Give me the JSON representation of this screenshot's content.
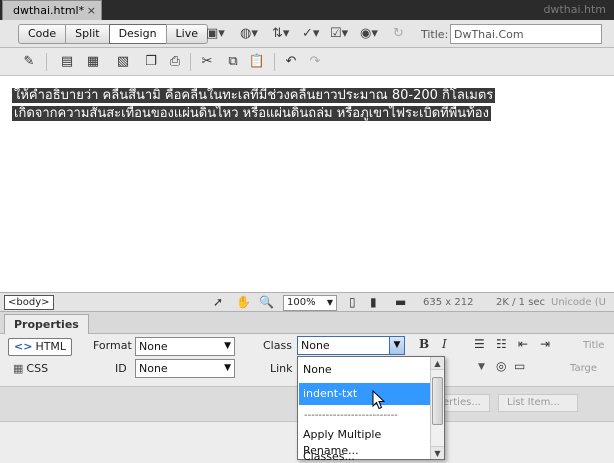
{
  "tabs": {
    "active_label": "dwthai.html*",
    "close_label": "×",
    "ghost_label": "dwthai.htm"
  },
  "document_toolbar": {
    "views": [
      "Code",
      "Split",
      "Design",
      "Live"
    ],
    "active_view": "Design",
    "title_label": "Title:",
    "title_value": "DwThai.Com"
  },
  "canvas": {
    "line1": "ให้คำอธิบายว่า คลื่นสึนามิ คือคลื่นในทะเลที่มีช่วงคลื่นยาวประมาณ 80-200 กิโลเมตร",
    "line2": "เกิดจากความสั่นสะเทือนของแผ่นดินไหว หรือแผ่นดินถล่ม หรือภูเขาไฟระเบิดที่พื้นท้อง"
  },
  "status_bar": {
    "tag": "<body>",
    "zoom": "100%",
    "window_size": "635 x 212",
    "download": "2K / 1 sec",
    "encoding": "Unicode (U"
  },
  "properties": {
    "tab_label": "Properties",
    "html_mode": "HTML",
    "css_mode": "CSS",
    "format_label": "Format",
    "format_value": "None",
    "id_label": "ID",
    "id_value": "None",
    "class_label": "Class",
    "class_value": "None",
    "link_label": "Link",
    "bold": "B",
    "italic": "I",
    "title_faded": "Title",
    "target_faded": "Targe",
    "page_properties_faded": "erties...",
    "list_item_faded": "List Item..."
  },
  "class_dropdown": {
    "items": [
      "None",
      "indent-txt",
      "--------------------------",
      "Apply Multiple Classes...",
      "Rename..."
    ],
    "highlighted_index": 1
  }
}
